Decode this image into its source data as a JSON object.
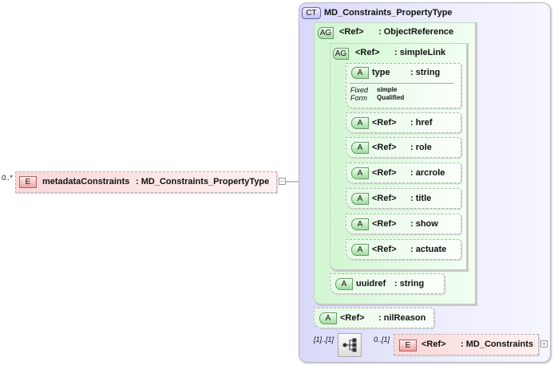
{
  "root": {
    "cardinality": "0..*",
    "badge": "E",
    "name": "metadataConstraints",
    "type": ": MD_Constraints_PropertyType",
    "toggle": "−"
  },
  "complex_type": {
    "badge": "CT",
    "name": "MD_Constraints_PropertyType"
  },
  "object_reference": {
    "badge": "AG",
    "ref": "<Ref>",
    "type": ": ObjectReference"
  },
  "simple_link": {
    "badge": "AG",
    "ref": "<Ref>",
    "type": ": simpleLink"
  },
  "type_attr": {
    "badge": "A",
    "name": "type",
    "type": ": string",
    "fixed_label": "Fixed",
    "fixed_value": "simple",
    "form_label": "Form",
    "form_value": "Qualified"
  },
  "link_attrs": [
    {
      "badge": "A",
      "ref": "<Ref>",
      "type": ": href"
    },
    {
      "badge": "A",
      "ref": "<Ref>",
      "type": ": role"
    },
    {
      "badge": "A",
      "ref": "<Ref>",
      "type": ": arcrole"
    },
    {
      "badge": "A",
      "ref": "<Ref>",
      "type": ": title"
    },
    {
      "badge": "A",
      "ref": "<Ref>",
      "type": ": show"
    },
    {
      "badge": "A",
      "ref": "<Ref>",
      "type": ": actuate"
    }
  ],
  "uuidref": {
    "badge": "A",
    "name": "uuidref",
    "type": ": string"
  },
  "nil_reason": {
    "badge": "A",
    "ref": "<Ref>",
    "type": ": nilReason"
  },
  "sequence": {
    "cardinality": "[1]..[1]"
  },
  "md_constraints": {
    "cardinality": "0..[1]",
    "badge": "E",
    "ref": "<Ref>",
    "type": ": MD_Constraints",
    "toggle": "+"
  }
}
